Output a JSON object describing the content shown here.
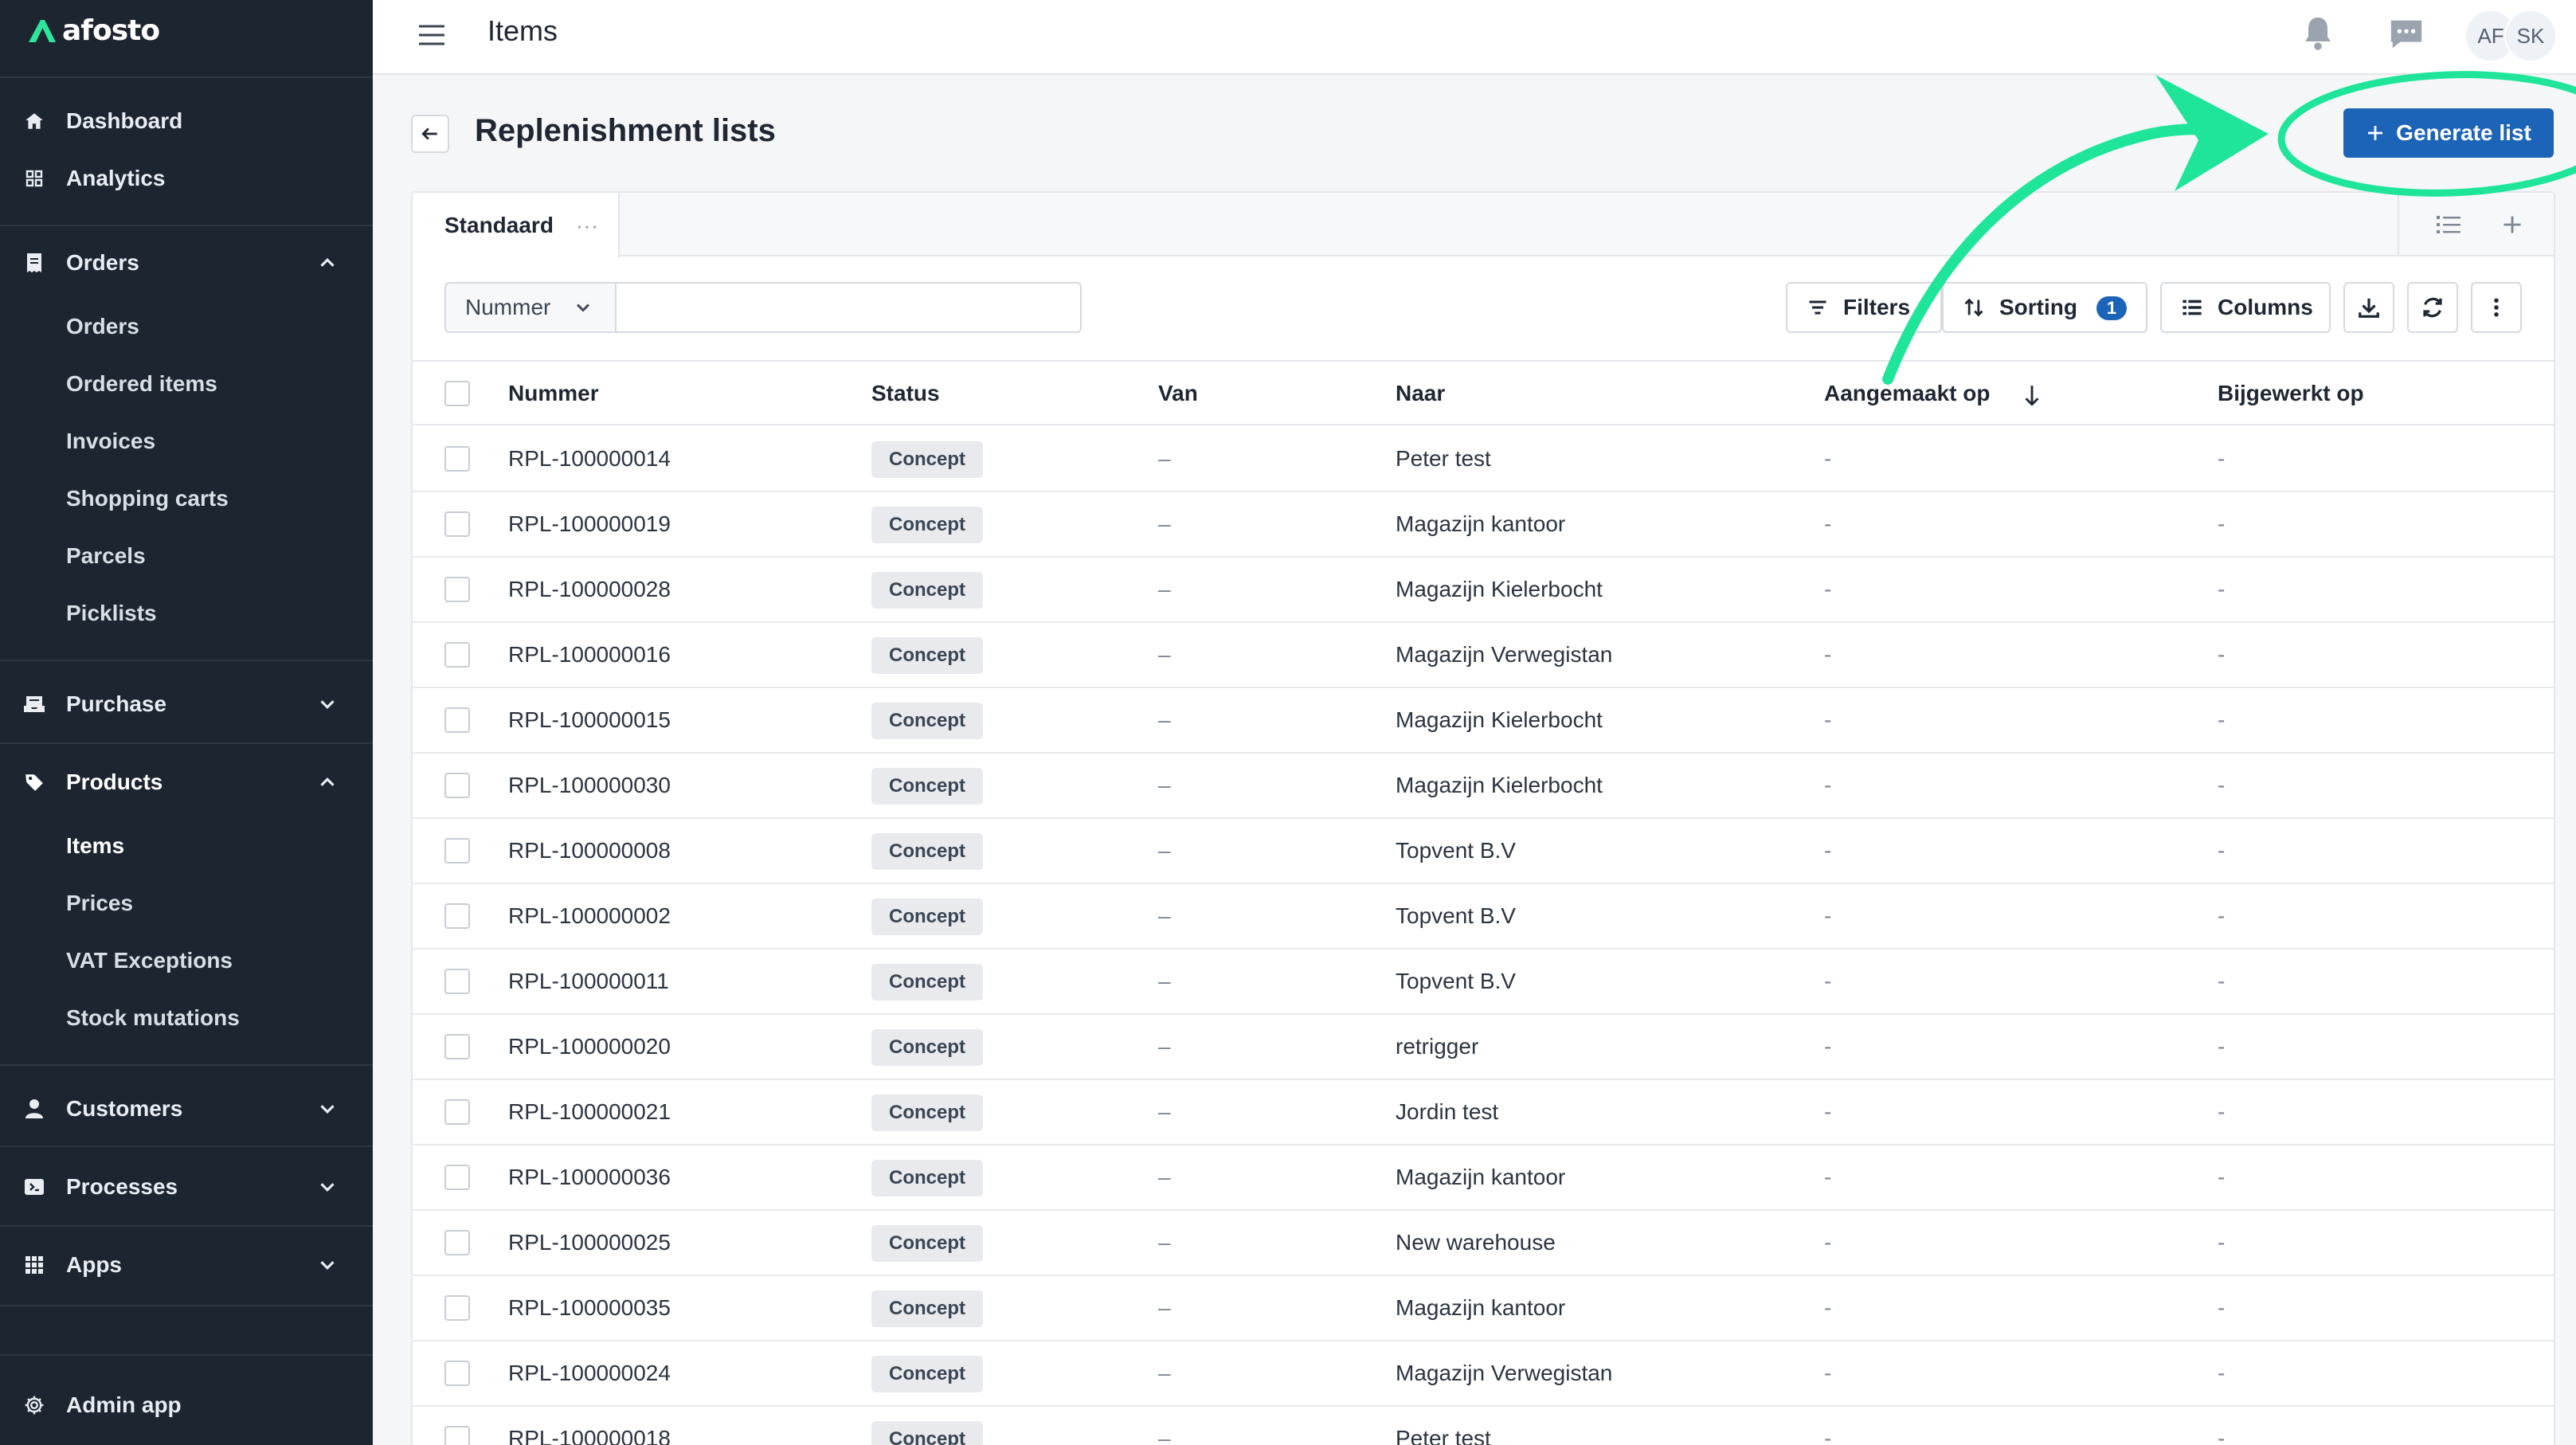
{
  "app": {
    "logo_text": "afosto"
  },
  "sidebar": {
    "dashboard": "Dashboard",
    "analytics": "Analytics",
    "orders": {
      "label": "Orders",
      "items": [
        "Orders",
        "Ordered items",
        "Invoices",
        "Shopping carts",
        "Parcels",
        "Picklists"
      ]
    },
    "purchase": "Purchase",
    "products": {
      "label": "Products",
      "items": [
        "Items",
        "Prices",
        "VAT Exceptions",
        "Stock mutations"
      ],
      "active": "Items"
    },
    "customers": "Customers",
    "processes": "Processes",
    "apps": "Apps",
    "admin_app": "Admin app"
  },
  "topbar": {
    "title": "Items",
    "avatars": [
      "AF",
      "SK"
    ]
  },
  "page": {
    "title": "Replenishment lists",
    "generate_label": "Generate list"
  },
  "view_tabs": {
    "active": "Standaard",
    "more": "···"
  },
  "toolbar": {
    "filter_field": "Nummer",
    "search_value": "",
    "filters_label": "Filters",
    "sorting_label": "Sorting",
    "sorting_count": "1",
    "columns_label": "Columns"
  },
  "table": {
    "columns": [
      "Nummer",
      "Status",
      "Van",
      "Naar",
      "Aangemaakt op",
      "Bijgewerkt op"
    ],
    "rows": [
      {
        "nummer": "RPL-100000014",
        "status": "Concept",
        "van": "–",
        "naar": "Peter test",
        "aangemaakt": "-",
        "bijgewerkt": "-"
      },
      {
        "nummer": "RPL-100000019",
        "status": "Concept",
        "van": "–",
        "naar": "Magazijn kantoor",
        "aangemaakt": "-",
        "bijgewerkt": "-"
      },
      {
        "nummer": "RPL-100000028",
        "status": "Concept",
        "van": "–",
        "naar": "Magazijn Kielerbocht",
        "aangemaakt": "-",
        "bijgewerkt": "-"
      },
      {
        "nummer": "RPL-100000016",
        "status": "Concept",
        "van": "–",
        "naar": "Magazijn Verwegistan",
        "aangemaakt": "-",
        "bijgewerkt": "-"
      },
      {
        "nummer": "RPL-100000015",
        "status": "Concept",
        "van": "–",
        "naar": "Magazijn Kielerbocht",
        "aangemaakt": "-",
        "bijgewerkt": "-"
      },
      {
        "nummer": "RPL-100000030",
        "status": "Concept",
        "van": "–",
        "naar": "Magazijn Kielerbocht",
        "aangemaakt": "-",
        "bijgewerkt": "-"
      },
      {
        "nummer": "RPL-100000008",
        "status": "Concept",
        "van": "–",
        "naar": "Topvent B.V",
        "aangemaakt": "-",
        "bijgewerkt": "-"
      },
      {
        "nummer": "RPL-100000002",
        "status": "Concept",
        "van": "–",
        "naar": "Topvent B.V",
        "aangemaakt": "-",
        "bijgewerkt": "-"
      },
      {
        "nummer": "RPL-100000011",
        "status": "Concept",
        "van": "–",
        "naar": "Topvent B.V",
        "aangemaakt": "-",
        "bijgewerkt": "-"
      },
      {
        "nummer": "RPL-100000020",
        "status": "Concept",
        "van": "–",
        "naar": "retrigger",
        "aangemaakt": "-",
        "bijgewerkt": "-"
      },
      {
        "nummer": "RPL-100000021",
        "status": "Concept",
        "van": "–",
        "naar": "Jordin test",
        "aangemaakt": "-",
        "bijgewerkt": "-"
      },
      {
        "nummer": "RPL-100000036",
        "status": "Concept",
        "van": "–",
        "naar": "Magazijn kantoor",
        "aangemaakt": "-",
        "bijgewerkt": "-"
      },
      {
        "nummer": "RPL-100000025",
        "status": "Concept",
        "van": "–",
        "naar": "New warehouse",
        "aangemaakt": "-",
        "bijgewerkt": "-"
      },
      {
        "nummer": "RPL-100000035",
        "status": "Concept",
        "van": "–",
        "naar": "Magazijn kantoor",
        "aangemaakt": "-",
        "bijgewerkt": "-"
      },
      {
        "nummer": "RPL-100000024",
        "status": "Concept",
        "van": "–",
        "naar": "Magazijn Verwegistan",
        "aangemaakt": "-",
        "bijgewerkt": "-"
      },
      {
        "nummer": "RPL-100000018",
        "status": "Concept",
        "van": "–",
        "naar": "Peter test",
        "aangemaakt": "-",
        "bijgewerkt": "-"
      }
    ]
  },
  "colors": {
    "sidebar_bg": "#1c2530",
    "primary": "#1c64b8",
    "annotation": "#1fe59a",
    "brand_green": "#2ee59d"
  },
  "icons": {
    "sidebar": [
      "home-icon",
      "grid-icon",
      "receipt-icon",
      "inbox-icon",
      "tag-icon",
      "person-icon",
      "process-icon",
      "apps-icon",
      "gear-icon"
    ],
    "topbar": [
      "hamburger-icon",
      "bell-icon",
      "chat-icon"
    ],
    "toolbar": [
      "filter-lines-icon",
      "sort-arrows-icon",
      "columns-icon",
      "download-icon",
      "refresh-icon",
      "kebab-icon"
    ]
  }
}
